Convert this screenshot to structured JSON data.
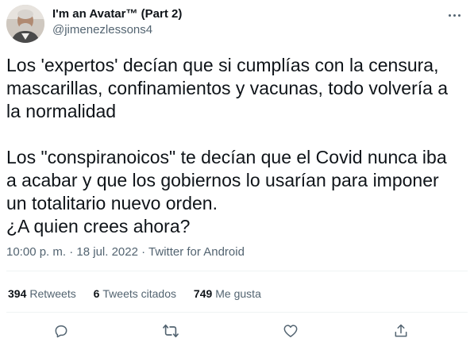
{
  "author": {
    "display_name": "I'm an Avatar™ (Part 2)",
    "handle": "@jimenezlessons4"
  },
  "tweet": {
    "text": "Los 'expertos' decían que si cumplías con la censura,\nmascarillas, confinamientos y vacunas, todo volvería a\nla normalidad\n\nLos \"conspiranoicos\" te decían que el Covid nunca iba\na acabar y que los gobiernos lo usarían para imponer\nun totalitario nuevo orden.\n¿A quien crees ahora?",
    "time": "10:00 p. m.",
    "date": "18 jul. 2022",
    "source": "Twitter for Android",
    "separator": "·"
  },
  "stats": {
    "retweets_count": "394",
    "retweets_label": "Retweets",
    "quotes_count": "6",
    "quotes_label": "Tweets citados",
    "likes_count": "749",
    "likes_label": "Me gusta"
  },
  "icons": {
    "more": "more-options-icon",
    "reply": "reply-icon",
    "retweet": "retweet-icon",
    "like": "like-icon",
    "share": "share-icon"
  },
  "colors": {
    "text_primary": "#0f1419",
    "text_secondary": "#536471",
    "divider": "#eff3f4"
  }
}
